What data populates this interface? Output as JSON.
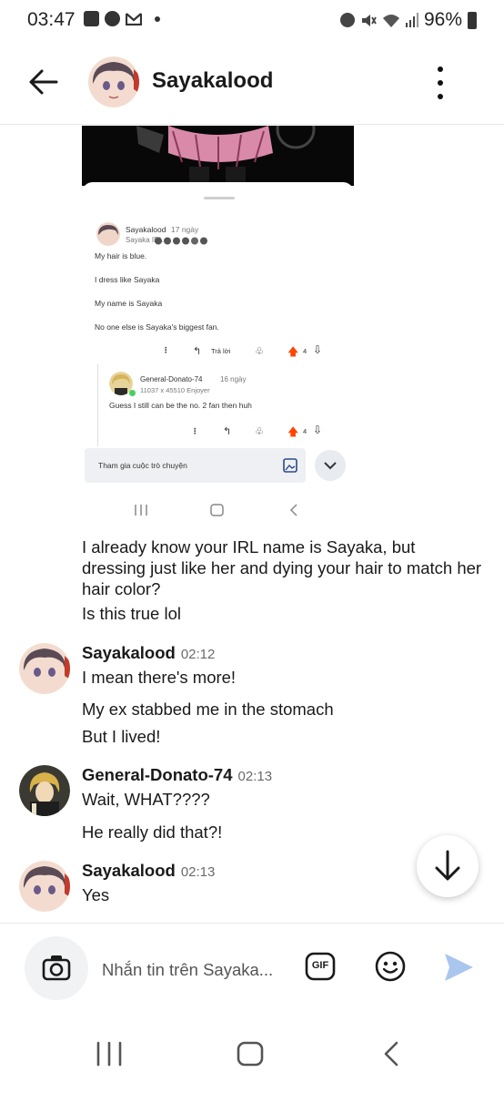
{
  "status_bar": {
    "time": "03:47",
    "battery": "96%",
    "icons": [
      "gallery-icon",
      "soccer-icon",
      "gmail-icon",
      "dot-icon",
      "alarm-icon",
      "mute-icon",
      "wifi-icon",
      "signal-icon",
      "battery-icon"
    ]
  },
  "header": {
    "title": "Sayakalood",
    "back_icon": "arrow-left-icon",
    "menu_icon": "kebab-icon"
  },
  "shared_screenshot": {
    "post": {
      "author": "Sayakalood",
      "age": "17 ngày",
      "flair": "Sayaka IRL",
      "lines": [
        "My hair is blue.",
        "I dress like Sayaka",
        "My name is Sayaka",
        "No one else is Sayaka's biggest fan."
      ],
      "reply_label": "Trả lời",
      "votes": "4"
    },
    "reply": {
      "author": "General-Donato-74",
      "age": "16 ngày",
      "flair": "11037 x 45510 Enjoyer",
      "text": "Guess I still can be the no. 2 fan then huh",
      "votes": "4"
    },
    "input_placeholder": "Tham gia cuộc trò chuyện"
  },
  "messages": [
    {
      "type": "continuation",
      "lines": [
        "I already know your IRL name is Sayaka, but dressing just like her and dying your hair to match her hair color?",
        "Is this true lol"
      ]
    },
    {
      "type": "group",
      "author": "Sayakalood",
      "time": "02:12",
      "lines": [
        "I mean there's more!",
        "My ex stabbed me in the stomach",
        "But I lived!"
      ]
    },
    {
      "type": "group",
      "author": "General-Donato-74",
      "time": "02:13",
      "lines": [
        "Wait, WHAT????",
        "He really did that?!"
      ]
    },
    {
      "type": "group",
      "author": "Sayakalood",
      "time": "02:13",
      "lines": [
        "Yes"
      ]
    }
  ],
  "composer": {
    "placeholder": "Nhắn tin trên Sayaka...",
    "gif_label": "GIF",
    "icons": [
      "camera-icon",
      "gif-icon",
      "emoji-icon",
      "send-icon"
    ]
  },
  "colors": {
    "accent": "#4b7bec",
    "send": "#a9c6ef",
    "upvote": "#ff4500"
  }
}
